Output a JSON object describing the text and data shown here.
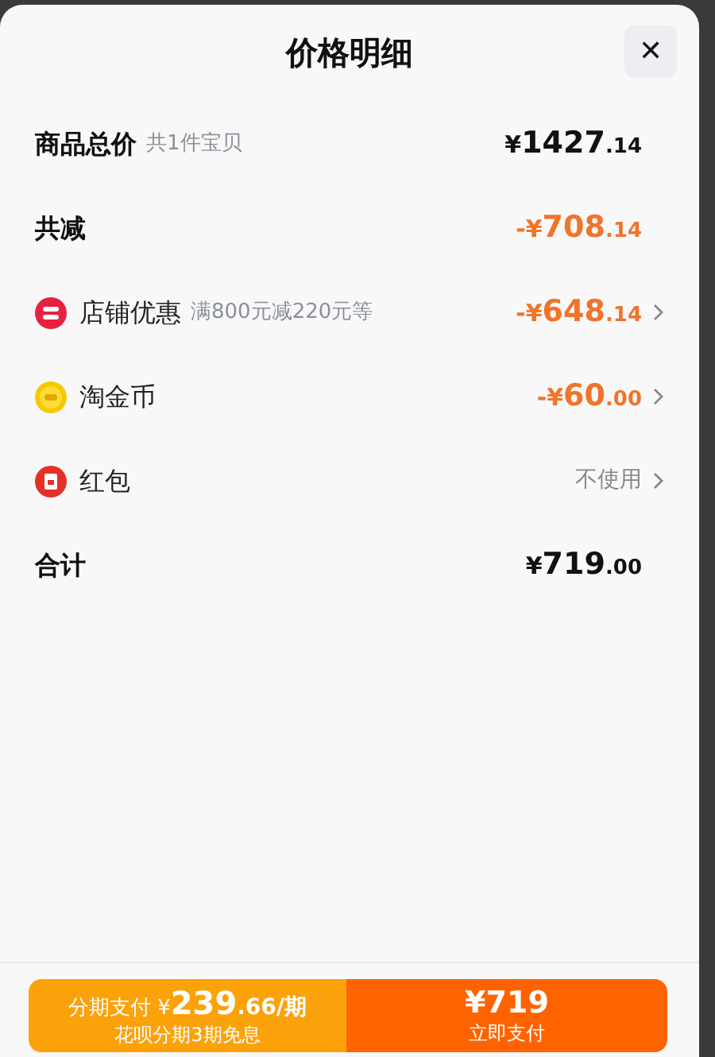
{
  "sheet": {
    "title": "价格明细",
    "close": "✕"
  },
  "rows": [
    {
      "kind": "plain",
      "label": "商品总价",
      "note": "共1件宝贝",
      "value": "¥1427.14",
      "discount": false,
      "unused": false,
      "chevron": false
    },
    {
      "kind": "plain",
      "label": "共减",
      "value": "-¥708.14",
      "discount": true,
      "unused": false,
      "chevron": false
    },
    {
      "kind": "shop",
      "label": "店铺优惠",
      "note": "满800元减220元等",
      "value": "-¥648.14",
      "discount": true,
      "unused": false,
      "chevron": true
    },
    {
      "kind": "coin",
      "label": "淘金币",
      "value": "-¥60.00",
      "discount": true,
      "unused": false,
      "chevron": true
    },
    {
      "kind": "packet",
      "label": "红包",
      "value": "不使用",
      "discount": false,
      "unused": true,
      "chevron": true
    },
    {
      "kind": "plain",
      "label": "合计",
      "value": "¥719.00",
      "discount": false,
      "unused": false,
      "chevron": false
    }
  ],
  "footer": {
    "installment": {
      "line1_prefix": "分期支付 ¥",
      "amount": "239",
      "fraction": ".66/期",
      "line2": "花呗分期3期免息"
    },
    "pay": {
      "amount": "¥719",
      "label": "立即支付"
    }
  }
}
